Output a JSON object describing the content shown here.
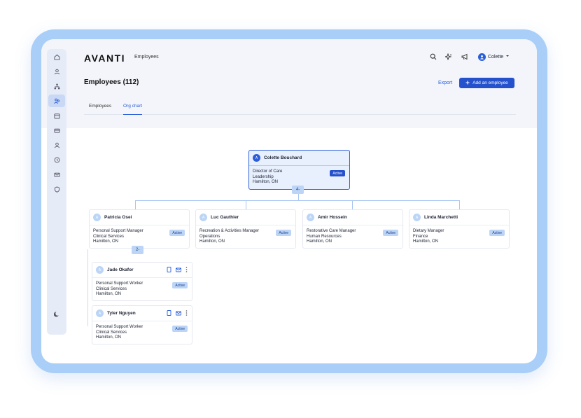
{
  "app": {
    "logo": "AVANTI",
    "breadcrumb": "Employees",
    "user_name": "Colette"
  },
  "header": {
    "title": "Employees (112)",
    "export_label": "Export",
    "add_label": "Add an employee"
  },
  "tabs": [
    {
      "label": "Employees",
      "active": false
    },
    {
      "label": "Org chart",
      "active": true
    }
  ],
  "sidebar": {
    "icons": [
      "home-icon",
      "person-icon",
      "org-icon",
      "team-icon",
      "calendar-icon",
      "card-icon",
      "user-icon",
      "clock-icon",
      "mail-icon",
      "shield-icon"
    ],
    "theme_icon": "moon-icon"
  },
  "org": {
    "root": {
      "initial": "A",
      "name": "Colette Bouchard",
      "title": "Director of Care",
      "dept": "Leadership",
      "location": "Hamilton, ON",
      "status": "Active",
      "reports": "4-"
    },
    "reports": [
      {
        "initial": "A",
        "name": "Patricia Osei",
        "title": "Personal Support Manager",
        "dept": "Clinical Services",
        "location": "Hamilton, ON",
        "status": "Active",
        "reports": "2-"
      },
      {
        "initial": "A",
        "name": "Luc Gauthier",
        "title": "Recreation & Activities Manager",
        "dept": "Operations",
        "location": "Hamilton, ON",
        "status": "Active"
      },
      {
        "initial": "A",
        "name": "Amir Hossein",
        "title": "Restorative Care Manager",
        "dept": "Human Resources",
        "location": "Hamilton, ON",
        "status": "Active"
      },
      {
        "initial": "A",
        "name": "Linda Marchetti",
        "title": "Dietary Manager",
        "dept": "Finance",
        "location": "Hamilton, ON",
        "status": "Active"
      }
    ],
    "sub_reports": [
      {
        "initial": "A",
        "name": "Jade Okafor",
        "title": "Personal Support Worker",
        "dept": "Clinical Services",
        "location": "Hamilton, ON",
        "status": "Active"
      },
      {
        "initial": "A",
        "name": "Tyler Nguyen",
        "title": "Personal Support Worker",
        "dept": "Clinical Services",
        "location": "Hamilton, ON",
        "status": "Active"
      }
    ]
  },
  "colors": {
    "accent": "#2552cc",
    "frame": "#a9cef8",
    "badge": "#bcd5f6"
  }
}
